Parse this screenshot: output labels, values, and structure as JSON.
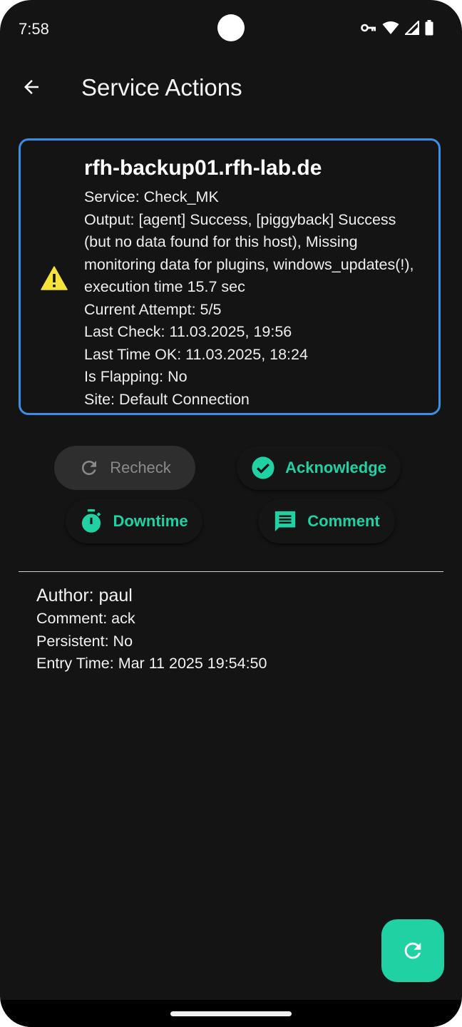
{
  "status_bar": {
    "time": "7:58",
    "icons": [
      "vpn-key-icon",
      "wifi-icon",
      "signal-icon",
      "battery-icon"
    ]
  },
  "app_bar": {
    "back_icon": "arrow-back-icon",
    "title": "Service Actions"
  },
  "service": {
    "status_icon": "warning-icon",
    "host": "rfh-backup01.rfh-lab.de",
    "service": "Service: Check_MK",
    "output": "Output: [agent] Success, [piggyback] Success (but no data found for this host), Missing monitoring data for plugins, windows_updates(!), execution time 15.7 sec",
    "current_attempt": "Current Attempt: 5/5",
    "last_check": "Last Check: 11.03.2025, 19:56",
    "last_time_ok": "Last Time OK: 11.03.2025, 18:24",
    "is_flapping": "Is Flapping: No",
    "site": "Site: Default Connection"
  },
  "actions": {
    "recheck": "Recheck",
    "acknowledge": "Acknowledge",
    "downtime": "Downtime",
    "comment": "Comment"
  },
  "comment": {
    "author": "Author: paul",
    "comment": "Comment: ack",
    "persistent": "Persistent: No",
    "entry_time": "Entry Time: Mar 11 2025 19:54:50"
  },
  "fab": {
    "icon": "refresh-icon"
  },
  "colors": {
    "background": "#141414",
    "accent": "#1fd1a3",
    "card_border": "#3b8ee6",
    "warning": "#f5e23a"
  }
}
